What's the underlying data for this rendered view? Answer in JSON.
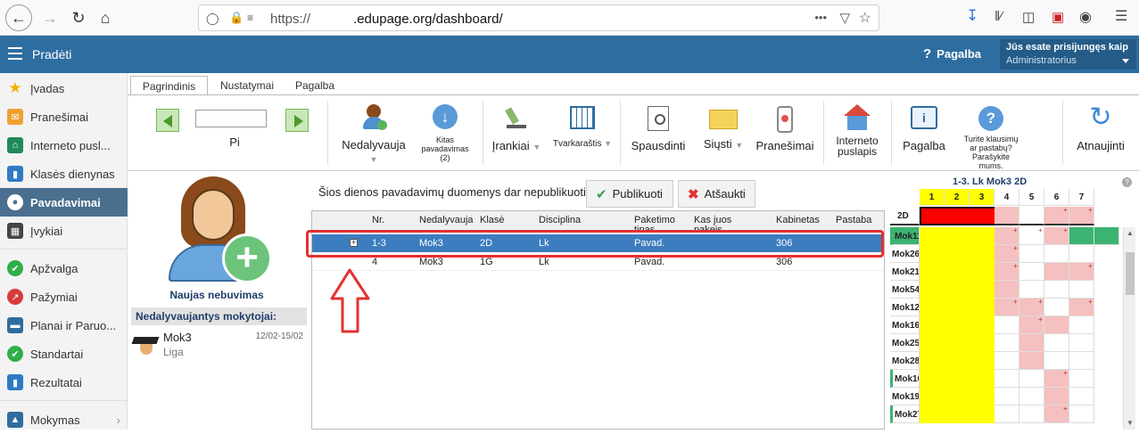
{
  "browser": {
    "url_prefix": "https://",
    "url_domain": ".edupage.org/dashboard/",
    "menu_dots": "•••"
  },
  "header": {
    "menu_label": "Pradėti",
    "help_label": "Pagalba",
    "user_line1": "Jūs esate prisijungęs kaip",
    "user_line2": "Administratorius"
  },
  "sidebar": {
    "items": [
      {
        "label": "Įvadas",
        "icon": "star-icon",
        "color": "#f2b200"
      },
      {
        "label": "Pranešimai",
        "icon": "envelope-icon",
        "color": "#f0a030"
      },
      {
        "label": "Interneto pusl...",
        "icon": "house-icon",
        "color": "#1f8a5b"
      },
      {
        "label": "Klasės dienynas",
        "icon": "book-icon",
        "color": "#2e7bc4"
      },
      {
        "label": "Pavadavimai",
        "icon": "person-icon",
        "color": "#ffffff"
      },
      {
        "label": "Įvykiai",
        "icon": "calendar-icon",
        "color": "#444444"
      },
      {
        "label": "Apžvalga",
        "icon": "check-circle-icon",
        "color": "#2fae4a"
      },
      {
        "label": "Pažymiai",
        "icon": "chart-icon",
        "color": "#d83b3b"
      },
      {
        "label": "Planai ir Paruo...",
        "icon": "briefcase-icon",
        "color": "#2e6da0"
      },
      {
        "label": "Standartai",
        "icon": "shield-icon",
        "color": "#2fae4a"
      },
      {
        "label": "Rezultatai",
        "icon": "bar-chart-icon",
        "color": "#2e7bc4"
      },
      {
        "label": "Mokymas",
        "icon": "graduation-icon",
        "color": "#2e6da0"
      }
    ]
  },
  "tabs": [
    "Pagrindinis",
    "Nustatymai",
    "Pagalba"
  ],
  "ribbon": {
    "day_label": "Pi",
    "absent_label": "Nedalyvauja",
    "other_subs_label": "Kitas pavadavimas",
    "other_subs_count": "(2)",
    "tools_label": "Įrankiai",
    "timetables_label": "Tvarkaraštis",
    "print_label": "Spausdinti",
    "send_label": "Siųsti",
    "notifications_label": "Pranešimai",
    "website_label": "Interneto puslapis",
    "help_label": "Pagalba",
    "questions_label": "Turite klausimų ar pastabų? Parašykite mums.",
    "refresh_label": "Atnaujinti"
  },
  "profile": {
    "new_absence_label": "Naujas nebuvimas",
    "absent_teachers_title": "Nedalyvaujantys mokytojai:",
    "teacher_name": "Mok3",
    "teacher_dates": "12/02-15/02",
    "teacher_reason": "Liga"
  },
  "subs": {
    "message": "Šios dienos pavadavimų duomenys dar nepublikuoti.",
    "publish_label": "Publikuoti",
    "cancel_label": "Atšaukti",
    "columns": [
      "Nr.",
      "Nedalyvauja",
      "Klasė",
      "Disciplina",
      "Paketimo tipas",
      "Kas juos pakeis",
      "Kabinetas",
      "Pastaba"
    ],
    "rows": [
      {
        "nr": "1-3",
        "absent": "Mok3",
        "class": "2D",
        "subject": "Lk",
        "type": "Pavad.",
        "replacement": "",
        "room": "306",
        "note": "",
        "selected": true
      },
      {
        "nr": "4",
        "absent": "Mok3",
        "class": "1G",
        "subject": "Lk",
        "type": "Pavad.",
        "replacement": "",
        "room": "306",
        "note": "",
        "selected": false
      }
    ]
  },
  "timetable": {
    "title": "1-3. Lk Mok3 2D",
    "periods": [
      "1",
      "2",
      "3",
      "4",
      "5",
      "6",
      "7"
    ],
    "class_row": "2D",
    "teachers": [
      "Mok11",
      "Mok26",
      "Mok21",
      "Mok54",
      "Mok12",
      "Mok16",
      "Mok25",
      "Mok28",
      "Mok10",
      "Mok19",
      "Mok27"
    ],
    "colors": {
      "selected": "#ffff00",
      "conflict": "#ff0000",
      "busy": "#f5c0c0",
      "free_green": "#3cb371"
    }
  },
  "accent_color": "#2e6da0",
  "selected_row_color": "#3d7dbf"
}
